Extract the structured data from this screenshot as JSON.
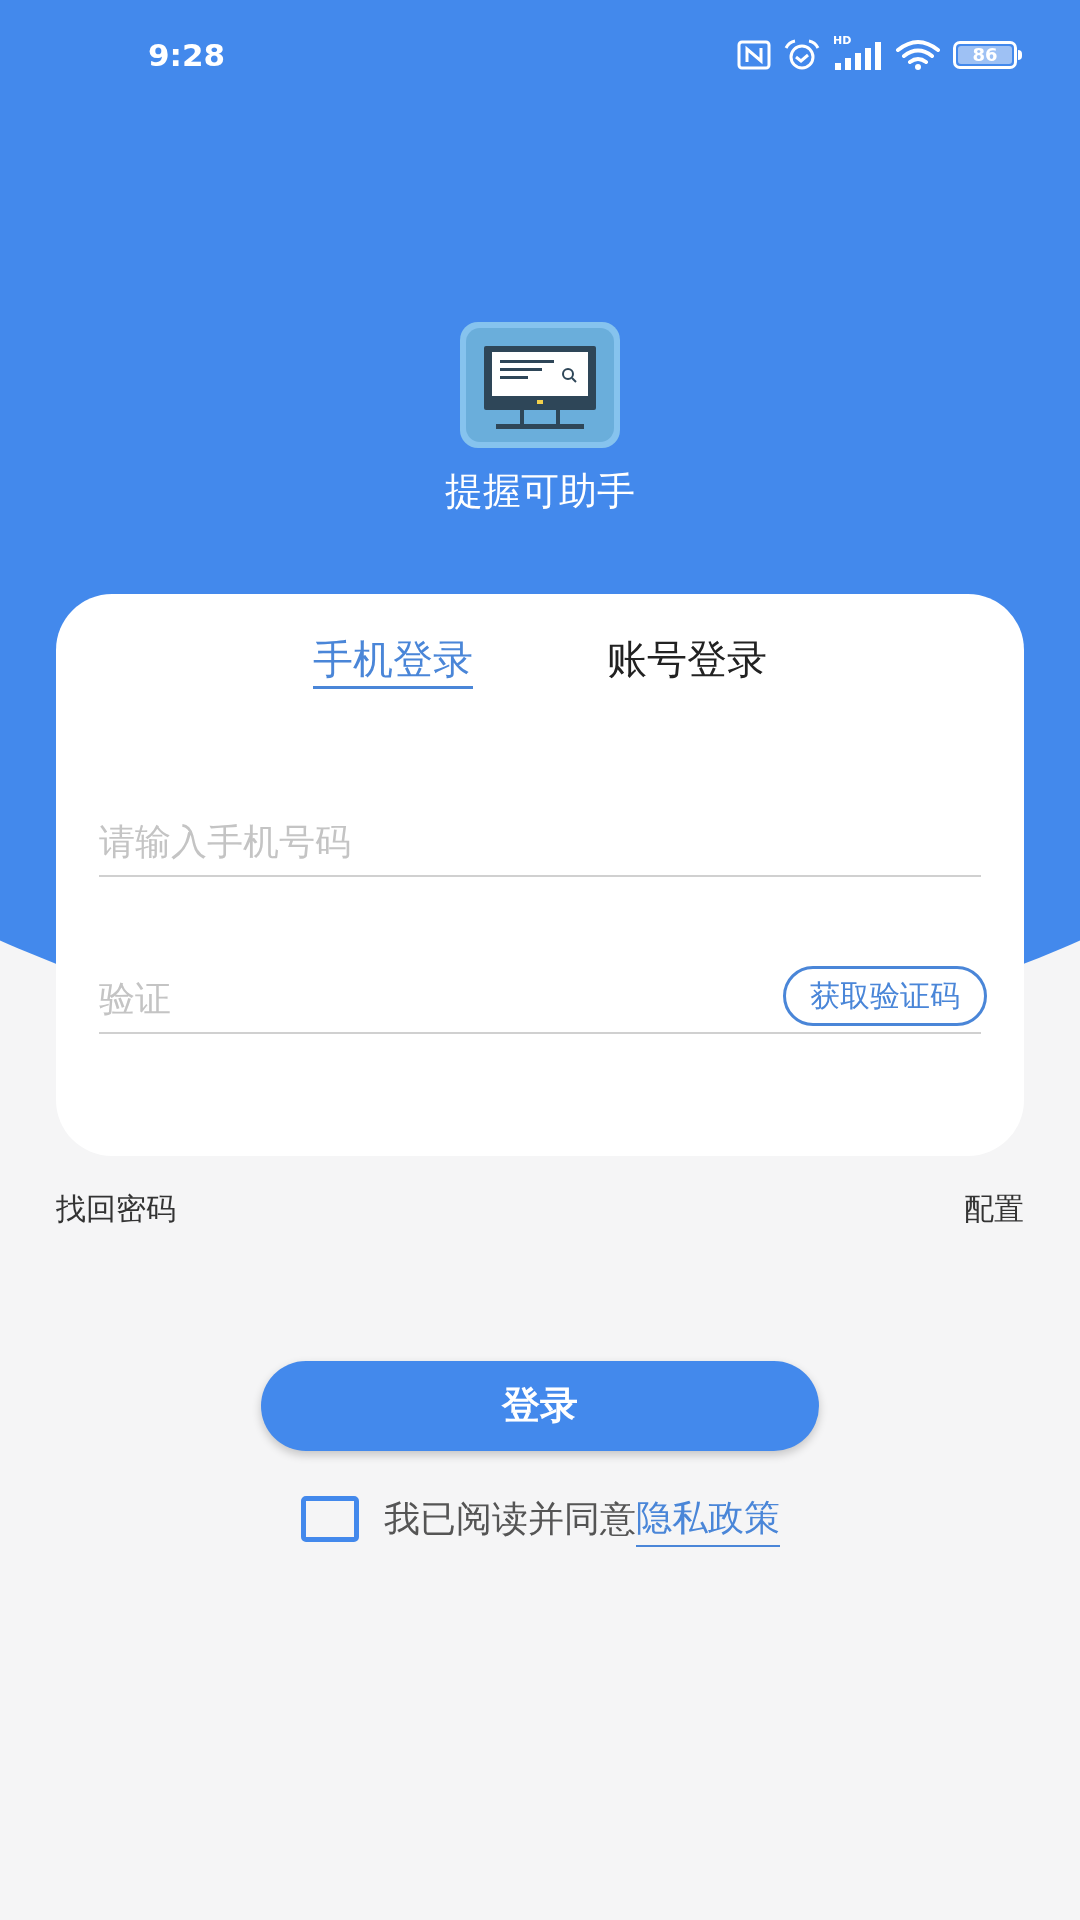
{
  "status_bar": {
    "time": "9:28",
    "network": "HD",
    "battery": "86"
  },
  "app": {
    "name": "提握可助手"
  },
  "tabs": [
    {
      "label": "手机登录",
      "selected": true
    },
    {
      "label": "账号登录",
      "selected": false
    }
  ],
  "fields": [
    {
      "kind": "phone",
      "placeholder": "请输入手机号码"
    },
    {
      "kind": "code",
      "placeholder": "验证",
      "action": "获取验证码"
    }
  ],
  "links": {
    "left": "找回密码",
    "right": "配置"
  },
  "login_button": "登录",
  "agreement": {
    "checked": false,
    "text": "我已阅读并同意",
    "link": "隐私政策"
  }
}
